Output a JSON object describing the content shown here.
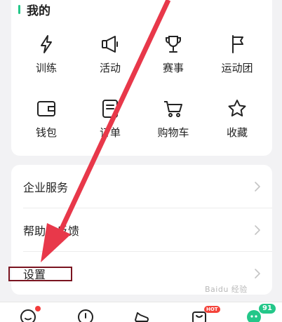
{
  "mine_section": {
    "title": "我的",
    "items": [
      {
        "label": "训练",
        "icon": "lightning-icon"
      },
      {
        "label": "活动",
        "icon": "megaphone-icon"
      },
      {
        "label": "赛事",
        "icon": "trophy-icon"
      },
      {
        "label": "运动团",
        "icon": "flag-icon"
      },
      {
        "label": "钱包",
        "icon": "wallet-icon"
      },
      {
        "label": "订单",
        "icon": "order-icon"
      },
      {
        "label": "购物车",
        "icon": "cart-icon"
      },
      {
        "label": "收藏",
        "icon": "star-icon"
      }
    ]
  },
  "list_section": {
    "items": [
      {
        "label": "企业服务"
      },
      {
        "label": "帮助与反馈"
      },
      {
        "label": "设置"
      }
    ]
  },
  "tabbar": {
    "hot_badge": "HOT",
    "count_badge": "91"
  },
  "watermark": "Baidu 经验",
  "colors": {
    "accent": "#24c789",
    "annotation_arrow": "#e8384a",
    "highlight_box": "#7a1420"
  }
}
